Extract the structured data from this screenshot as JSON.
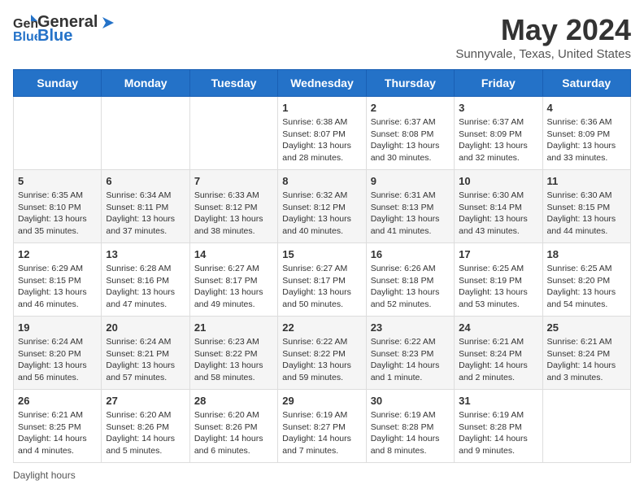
{
  "header": {
    "logo_general": "General",
    "logo_blue": "Blue",
    "title": "May 2024",
    "subtitle": "Sunnyvale, Texas, United States"
  },
  "calendar": {
    "days_of_week": [
      "Sunday",
      "Monday",
      "Tuesday",
      "Wednesday",
      "Thursday",
      "Friday",
      "Saturday"
    ],
    "weeks": [
      [
        {
          "day": "",
          "info": ""
        },
        {
          "day": "",
          "info": ""
        },
        {
          "day": "",
          "info": ""
        },
        {
          "day": "1",
          "info": "Sunrise: 6:38 AM\nSunset: 8:07 PM\nDaylight: 13 hours and 28 minutes."
        },
        {
          "day": "2",
          "info": "Sunrise: 6:37 AM\nSunset: 8:08 PM\nDaylight: 13 hours and 30 minutes."
        },
        {
          "day": "3",
          "info": "Sunrise: 6:37 AM\nSunset: 8:09 PM\nDaylight: 13 hours and 32 minutes."
        },
        {
          "day": "4",
          "info": "Sunrise: 6:36 AM\nSunset: 8:09 PM\nDaylight: 13 hours and 33 minutes."
        }
      ],
      [
        {
          "day": "5",
          "info": "Sunrise: 6:35 AM\nSunset: 8:10 PM\nDaylight: 13 hours and 35 minutes."
        },
        {
          "day": "6",
          "info": "Sunrise: 6:34 AM\nSunset: 8:11 PM\nDaylight: 13 hours and 37 minutes."
        },
        {
          "day": "7",
          "info": "Sunrise: 6:33 AM\nSunset: 8:12 PM\nDaylight: 13 hours and 38 minutes."
        },
        {
          "day": "8",
          "info": "Sunrise: 6:32 AM\nSunset: 8:12 PM\nDaylight: 13 hours and 40 minutes."
        },
        {
          "day": "9",
          "info": "Sunrise: 6:31 AM\nSunset: 8:13 PM\nDaylight: 13 hours and 41 minutes."
        },
        {
          "day": "10",
          "info": "Sunrise: 6:30 AM\nSunset: 8:14 PM\nDaylight: 13 hours and 43 minutes."
        },
        {
          "day": "11",
          "info": "Sunrise: 6:30 AM\nSunset: 8:15 PM\nDaylight: 13 hours and 44 minutes."
        }
      ],
      [
        {
          "day": "12",
          "info": "Sunrise: 6:29 AM\nSunset: 8:15 PM\nDaylight: 13 hours and 46 minutes."
        },
        {
          "day": "13",
          "info": "Sunrise: 6:28 AM\nSunset: 8:16 PM\nDaylight: 13 hours and 47 minutes."
        },
        {
          "day": "14",
          "info": "Sunrise: 6:27 AM\nSunset: 8:17 PM\nDaylight: 13 hours and 49 minutes."
        },
        {
          "day": "15",
          "info": "Sunrise: 6:27 AM\nSunset: 8:17 PM\nDaylight: 13 hours and 50 minutes."
        },
        {
          "day": "16",
          "info": "Sunrise: 6:26 AM\nSunset: 8:18 PM\nDaylight: 13 hours and 52 minutes."
        },
        {
          "day": "17",
          "info": "Sunrise: 6:25 AM\nSunset: 8:19 PM\nDaylight: 13 hours and 53 minutes."
        },
        {
          "day": "18",
          "info": "Sunrise: 6:25 AM\nSunset: 8:20 PM\nDaylight: 13 hours and 54 minutes."
        }
      ],
      [
        {
          "day": "19",
          "info": "Sunrise: 6:24 AM\nSunset: 8:20 PM\nDaylight: 13 hours and 56 minutes."
        },
        {
          "day": "20",
          "info": "Sunrise: 6:24 AM\nSunset: 8:21 PM\nDaylight: 13 hours and 57 minutes."
        },
        {
          "day": "21",
          "info": "Sunrise: 6:23 AM\nSunset: 8:22 PM\nDaylight: 13 hours and 58 minutes."
        },
        {
          "day": "22",
          "info": "Sunrise: 6:22 AM\nSunset: 8:22 PM\nDaylight: 13 hours and 59 minutes."
        },
        {
          "day": "23",
          "info": "Sunrise: 6:22 AM\nSunset: 8:23 PM\nDaylight: 14 hours and 1 minute."
        },
        {
          "day": "24",
          "info": "Sunrise: 6:21 AM\nSunset: 8:24 PM\nDaylight: 14 hours and 2 minutes."
        },
        {
          "day": "25",
          "info": "Sunrise: 6:21 AM\nSunset: 8:24 PM\nDaylight: 14 hours and 3 minutes."
        }
      ],
      [
        {
          "day": "26",
          "info": "Sunrise: 6:21 AM\nSunset: 8:25 PM\nDaylight: 14 hours and 4 minutes."
        },
        {
          "day": "27",
          "info": "Sunrise: 6:20 AM\nSunset: 8:26 PM\nDaylight: 14 hours and 5 minutes."
        },
        {
          "day": "28",
          "info": "Sunrise: 6:20 AM\nSunset: 8:26 PM\nDaylight: 14 hours and 6 minutes."
        },
        {
          "day": "29",
          "info": "Sunrise: 6:19 AM\nSunset: 8:27 PM\nDaylight: 14 hours and 7 minutes."
        },
        {
          "day": "30",
          "info": "Sunrise: 6:19 AM\nSunset: 8:28 PM\nDaylight: 14 hours and 8 minutes."
        },
        {
          "day": "31",
          "info": "Sunrise: 6:19 AM\nSunset: 8:28 PM\nDaylight: 14 hours and 9 minutes."
        },
        {
          "day": "",
          "info": ""
        }
      ]
    ]
  },
  "footer": {
    "daylight_label": "Daylight hours"
  }
}
